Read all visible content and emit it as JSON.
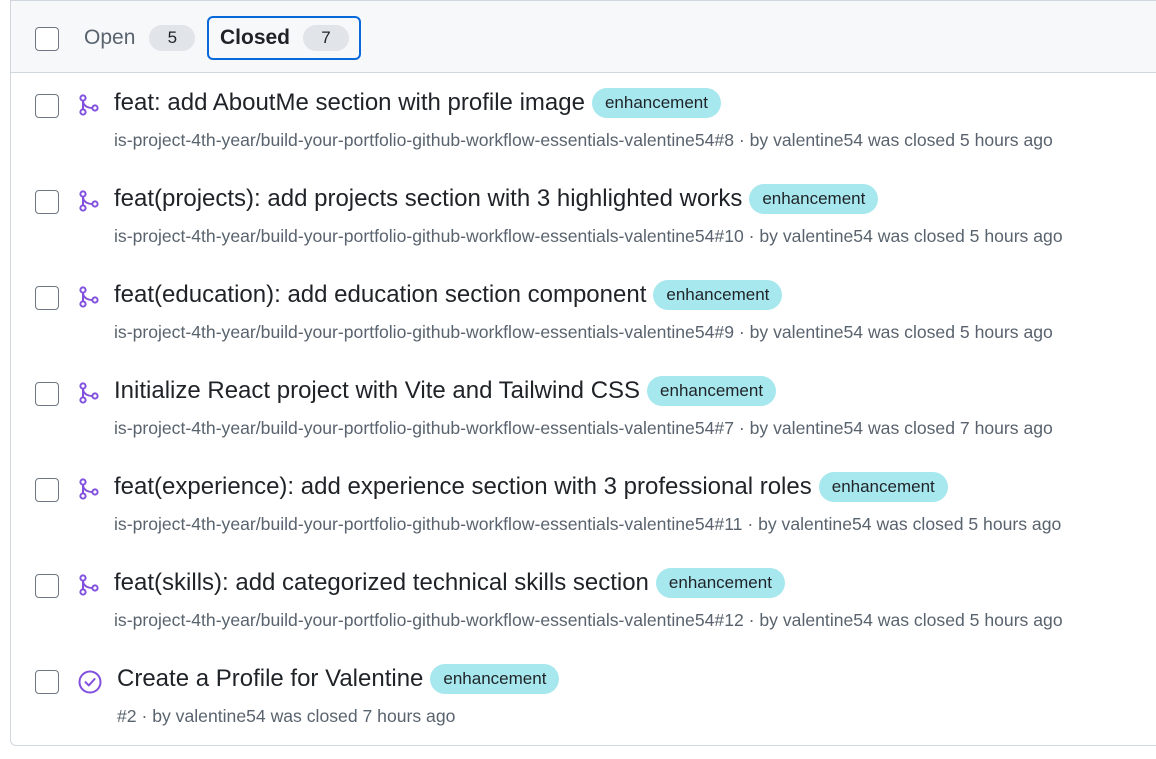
{
  "filter": {
    "open_label": "Open",
    "open_count": "5",
    "closed_label": "Closed",
    "closed_count": "7"
  },
  "items": [
    {
      "title": "feat: add AboutMe section with profile image",
      "label": "enhancement",
      "ref": "is-project-4th-year/build-your-portfolio-github-workflow-essentials-valentine54#8",
      "meta": " · by valentine54 was closed 5 hours ago",
      "icon": "pr-merged-icon"
    },
    {
      "title": "feat(projects): add projects section with 3 highlighted works",
      "label": "enhancement",
      "ref": "is-project-4th-year/build-your-portfolio-github-workflow-essentials-valentine54#10",
      "meta": " · by valentine54 was closed 5 hours ago",
      "icon": "pr-merged-icon"
    },
    {
      "title": "feat(education): add education section component",
      "label": "enhancement",
      "ref": "is-project-4th-year/build-your-portfolio-github-workflow-essentials-valentine54#9",
      "meta": " · by valentine54 was closed 5 hours ago",
      "icon": "pr-merged-icon"
    },
    {
      "title": "Initialize React project with Vite and Tailwind CSS",
      "label": "enhancement",
      "ref": "is-project-4th-year/build-your-portfolio-github-workflow-essentials-valentine54#7",
      "meta": " · by valentine54 was closed 7 hours ago",
      "icon": "pr-merged-icon"
    },
    {
      "title": "feat(experience): add experience section with 3 professional roles",
      "label": "enhancement",
      "ref": "is-project-4th-year/build-your-portfolio-github-workflow-essentials-valentine54#11",
      "meta": " · by valentine54 was closed 5 hours ago",
      "icon": "pr-merged-icon"
    },
    {
      "title": "feat(skills): add categorized technical skills section",
      "label": "enhancement",
      "ref": "is-project-4th-year/build-your-portfolio-github-workflow-essentials-valentine54#12",
      "meta": " · by valentine54 was closed 5 hours ago",
      "icon": "pr-merged-icon"
    },
    {
      "title": "Create a Profile for Valentine",
      "label": "enhancement",
      "ref": "#2",
      "meta": " · by valentine54 was closed 7 hours ago",
      "icon": "issue-closed-icon"
    }
  ],
  "colors": {
    "accent": "#0969da",
    "done_purple": "#8250df",
    "label_bg": "#a7e8ee"
  }
}
